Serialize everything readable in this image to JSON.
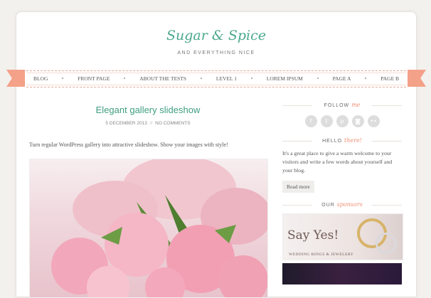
{
  "site": {
    "title": "Sugar & Spice",
    "tagline": "AND EVERYTHING NICE"
  },
  "nav": {
    "items": [
      "BLOG",
      "FRONT PAGE",
      "ABOUT THE TESTS",
      "LEVEL 1",
      "LOREM IPSUM",
      "PAGE A",
      "PAGE B"
    ]
  },
  "post": {
    "title": "Elegant gallery slideshow",
    "date": "5 DECEMBER 2013",
    "separator": "//",
    "comments": "NO COMMENTS",
    "excerpt": "Turn regular WordPress gallery into attractive slideshow. Show your images with style!"
  },
  "sidebar": {
    "follow": {
      "prefix": "FOLLOW",
      "accent": "me"
    },
    "hello": {
      "prefix": "HELLO",
      "accent": "there!"
    },
    "hello_text": "It's a great place to give a warm welcome to your visitors and write a few words about yourself and your blog.",
    "read_more": "Read more",
    "sponsors": {
      "prefix": "OUR",
      "accent": "sponsors"
    },
    "banner_text": "Say Yes!",
    "banner_sub": "WEDDING RINGS & JEWELERY",
    "social_icons": [
      "facebook-icon",
      "twitter-icon",
      "pinterest-icon",
      "instagram-icon",
      "flickr-icon"
    ]
  },
  "colors": {
    "accent_green": "#4aa88c",
    "accent_salmon": "#f4a189",
    "social_grey": "#dddddd"
  }
}
